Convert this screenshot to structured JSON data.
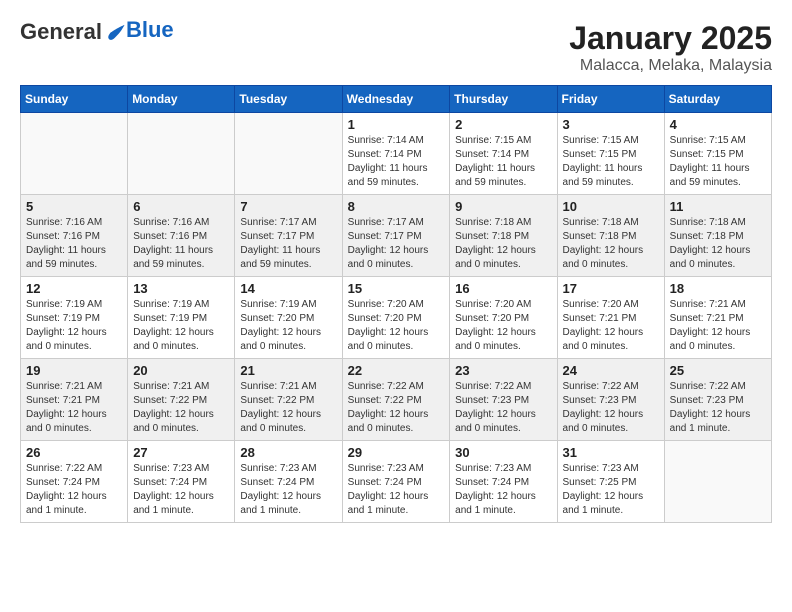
{
  "header": {
    "logo_line1": "General",
    "logo_line2": "Blue",
    "month": "January 2025",
    "location": "Malacca, Melaka, Malaysia"
  },
  "days_of_week": [
    "Sunday",
    "Monday",
    "Tuesday",
    "Wednesday",
    "Thursday",
    "Friday",
    "Saturday"
  ],
  "weeks": [
    [
      {
        "day": "",
        "info": ""
      },
      {
        "day": "",
        "info": ""
      },
      {
        "day": "",
        "info": ""
      },
      {
        "day": "1",
        "info": "Sunrise: 7:14 AM\nSunset: 7:14 PM\nDaylight: 11 hours\nand 59 minutes."
      },
      {
        "day": "2",
        "info": "Sunrise: 7:15 AM\nSunset: 7:14 PM\nDaylight: 11 hours\nand 59 minutes."
      },
      {
        "day": "3",
        "info": "Sunrise: 7:15 AM\nSunset: 7:15 PM\nDaylight: 11 hours\nand 59 minutes."
      },
      {
        "day": "4",
        "info": "Sunrise: 7:15 AM\nSunset: 7:15 PM\nDaylight: 11 hours\nand 59 minutes."
      }
    ],
    [
      {
        "day": "5",
        "info": "Sunrise: 7:16 AM\nSunset: 7:16 PM\nDaylight: 11 hours\nand 59 minutes."
      },
      {
        "day": "6",
        "info": "Sunrise: 7:16 AM\nSunset: 7:16 PM\nDaylight: 11 hours\nand 59 minutes."
      },
      {
        "day": "7",
        "info": "Sunrise: 7:17 AM\nSunset: 7:17 PM\nDaylight: 11 hours\nand 59 minutes."
      },
      {
        "day": "8",
        "info": "Sunrise: 7:17 AM\nSunset: 7:17 PM\nDaylight: 12 hours\nand 0 minutes."
      },
      {
        "day": "9",
        "info": "Sunrise: 7:18 AM\nSunset: 7:18 PM\nDaylight: 12 hours\nand 0 minutes."
      },
      {
        "day": "10",
        "info": "Sunrise: 7:18 AM\nSunset: 7:18 PM\nDaylight: 12 hours\nand 0 minutes."
      },
      {
        "day": "11",
        "info": "Sunrise: 7:18 AM\nSunset: 7:18 PM\nDaylight: 12 hours\nand 0 minutes."
      }
    ],
    [
      {
        "day": "12",
        "info": "Sunrise: 7:19 AM\nSunset: 7:19 PM\nDaylight: 12 hours\nand 0 minutes."
      },
      {
        "day": "13",
        "info": "Sunrise: 7:19 AM\nSunset: 7:19 PM\nDaylight: 12 hours\nand 0 minutes."
      },
      {
        "day": "14",
        "info": "Sunrise: 7:19 AM\nSunset: 7:20 PM\nDaylight: 12 hours\nand 0 minutes."
      },
      {
        "day": "15",
        "info": "Sunrise: 7:20 AM\nSunset: 7:20 PM\nDaylight: 12 hours\nand 0 minutes."
      },
      {
        "day": "16",
        "info": "Sunrise: 7:20 AM\nSunset: 7:20 PM\nDaylight: 12 hours\nand 0 minutes."
      },
      {
        "day": "17",
        "info": "Sunrise: 7:20 AM\nSunset: 7:21 PM\nDaylight: 12 hours\nand 0 minutes."
      },
      {
        "day": "18",
        "info": "Sunrise: 7:21 AM\nSunset: 7:21 PM\nDaylight: 12 hours\nand 0 minutes."
      }
    ],
    [
      {
        "day": "19",
        "info": "Sunrise: 7:21 AM\nSunset: 7:21 PM\nDaylight: 12 hours\nand 0 minutes."
      },
      {
        "day": "20",
        "info": "Sunrise: 7:21 AM\nSunset: 7:22 PM\nDaylight: 12 hours\nand 0 minutes."
      },
      {
        "day": "21",
        "info": "Sunrise: 7:21 AM\nSunset: 7:22 PM\nDaylight: 12 hours\nand 0 minutes."
      },
      {
        "day": "22",
        "info": "Sunrise: 7:22 AM\nSunset: 7:22 PM\nDaylight: 12 hours\nand 0 minutes."
      },
      {
        "day": "23",
        "info": "Sunrise: 7:22 AM\nSunset: 7:23 PM\nDaylight: 12 hours\nand 0 minutes."
      },
      {
        "day": "24",
        "info": "Sunrise: 7:22 AM\nSunset: 7:23 PM\nDaylight: 12 hours\nand 0 minutes."
      },
      {
        "day": "25",
        "info": "Sunrise: 7:22 AM\nSunset: 7:23 PM\nDaylight: 12 hours\nand 1 minute."
      }
    ],
    [
      {
        "day": "26",
        "info": "Sunrise: 7:22 AM\nSunset: 7:24 PM\nDaylight: 12 hours\nand 1 minute."
      },
      {
        "day": "27",
        "info": "Sunrise: 7:23 AM\nSunset: 7:24 PM\nDaylight: 12 hours\nand 1 minute."
      },
      {
        "day": "28",
        "info": "Sunrise: 7:23 AM\nSunset: 7:24 PM\nDaylight: 12 hours\nand 1 minute."
      },
      {
        "day": "29",
        "info": "Sunrise: 7:23 AM\nSunset: 7:24 PM\nDaylight: 12 hours\nand 1 minute."
      },
      {
        "day": "30",
        "info": "Sunrise: 7:23 AM\nSunset: 7:24 PM\nDaylight: 12 hours\nand 1 minute."
      },
      {
        "day": "31",
        "info": "Sunrise: 7:23 AM\nSunset: 7:25 PM\nDaylight: 12 hours\nand 1 minute."
      },
      {
        "day": "",
        "info": ""
      }
    ]
  ]
}
